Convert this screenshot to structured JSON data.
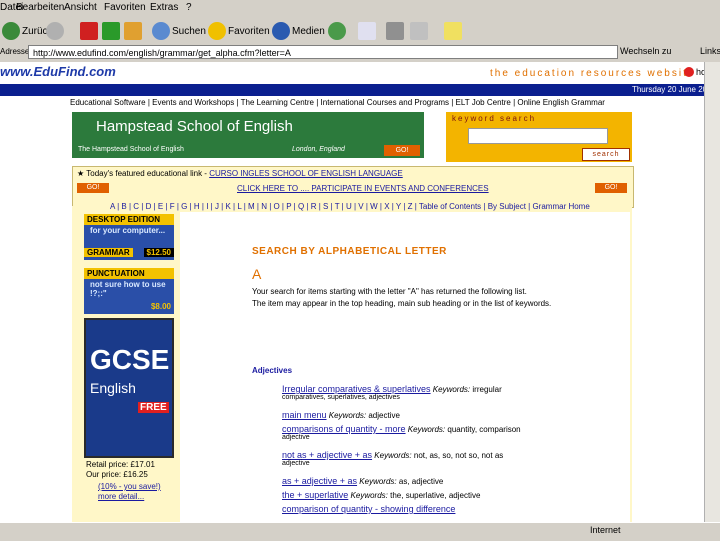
{
  "menu": [
    "Datei",
    "Bearbeiten",
    "Ansicht",
    "Favoriten",
    "Extras",
    "?"
  ],
  "toolbar": {
    "back_label": "Zurück",
    "search_label": "Suchen",
    "favorites_label": "Favoriten",
    "media_label": "Medien"
  },
  "address": {
    "label": "Adresse",
    "url": "http://www.edufind.com/english/grammar/get_alpha.cfm?letter=A",
    "go_label": "Wechseln zu",
    "links_label": "Links"
  },
  "site": {
    "logo": "www.EduFind.com",
    "tagline": "the education resources website",
    "home": "home",
    "date": "Thursday 20 June 2002",
    "nav": "Educational Software | Events and Workshops | The Learning Centre | International Courses and Programs | ELT Job Centre | Online English Grammar"
  },
  "banner": {
    "title": "Hampstead School of English",
    "subtitle": "The Hampstead School of English",
    "location": "London, England",
    "go": "GO!"
  },
  "keyword": {
    "title": "keyword search",
    "button": "search"
  },
  "featured": {
    "prefix": "★ Today's featured educational link - ",
    "link": "CURSO INGLES SCHOOL OF ENGLISH LANGUAGE",
    "go": "GO!",
    "click": "CLICK HERE TO .... PARTICIPATE IN EVENTS AND CONFERENCES"
  },
  "alphabet": "A | B | C | D | E | F | G | H | I | J | K | L | M | N | O | P | Q | R | S | T | U | V | W | X | Y | Z | Table of Contents | By Subject | Grammar Home",
  "sidebar": {
    "ad1_head": "DESKTOP EDITION",
    "ad1_body": "for your computer...",
    "ad1_name": "GRAMMAR",
    "ad1_price": "$12.50",
    "ad2_head": "PUNCTUATION",
    "ad2_body": "not sure how to use !?;:\"",
    "ad2_price": "$8.00",
    "book_title": "GCSE",
    "book_sub": "English",
    "book_free": "FREE",
    "retail": "Retail price: £17.01",
    "ourprice": "Our price: £16.25",
    "save": "(10% - you save!)",
    "more": "more detail..."
  },
  "main": {
    "title": "SEARCH BY ALPHABETICAL LETTER",
    "letter": "A",
    "para1": "Your search for items starting with the letter \"A\" has returned the following list.",
    "para2": "The item may appear in the top heading, main sub heading or in the list of keywords.",
    "adj_head": "Adjectives",
    "results": [
      {
        "link": "Irregular comparatives & superlatives",
        "kw": "Keywords:",
        "kwtext": "irregular",
        "sub": "comparatives, superlatives, adjectives"
      },
      {
        "link": "main menu",
        "kw": "Keywords:",
        "kwtext": "adjective",
        "sub": ""
      },
      {
        "link": "comparisons of quantity - more",
        "kw": "Keywords:",
        "kwtext": "quantity, comparison",
        "sub": "adjective"
      },
      {
        "link": "not as + adjective + as",
        "kw": "Keywords:",
        "kwtext": "not, as, so, not so, not as",
        "sub": "adjective"
      },
      {
        "link": "as + adjective + as",
        "kw": "Keywords:",
        "kwtext": "as, adjective",
        "sub": ""
      },
      {
        "link": "the + superlative",
        "kw": "Keywords:",
        "kwtext": "the, superlative, adjective",
        "sub": ""
      },
      {
        "link": "comparison of quantity - showing difference",
        "kw": "",
        "kwtext": "",
        "sub": ""
      }
    ]
  },
  "status": {
    "zone": "Internet"
  }
}
